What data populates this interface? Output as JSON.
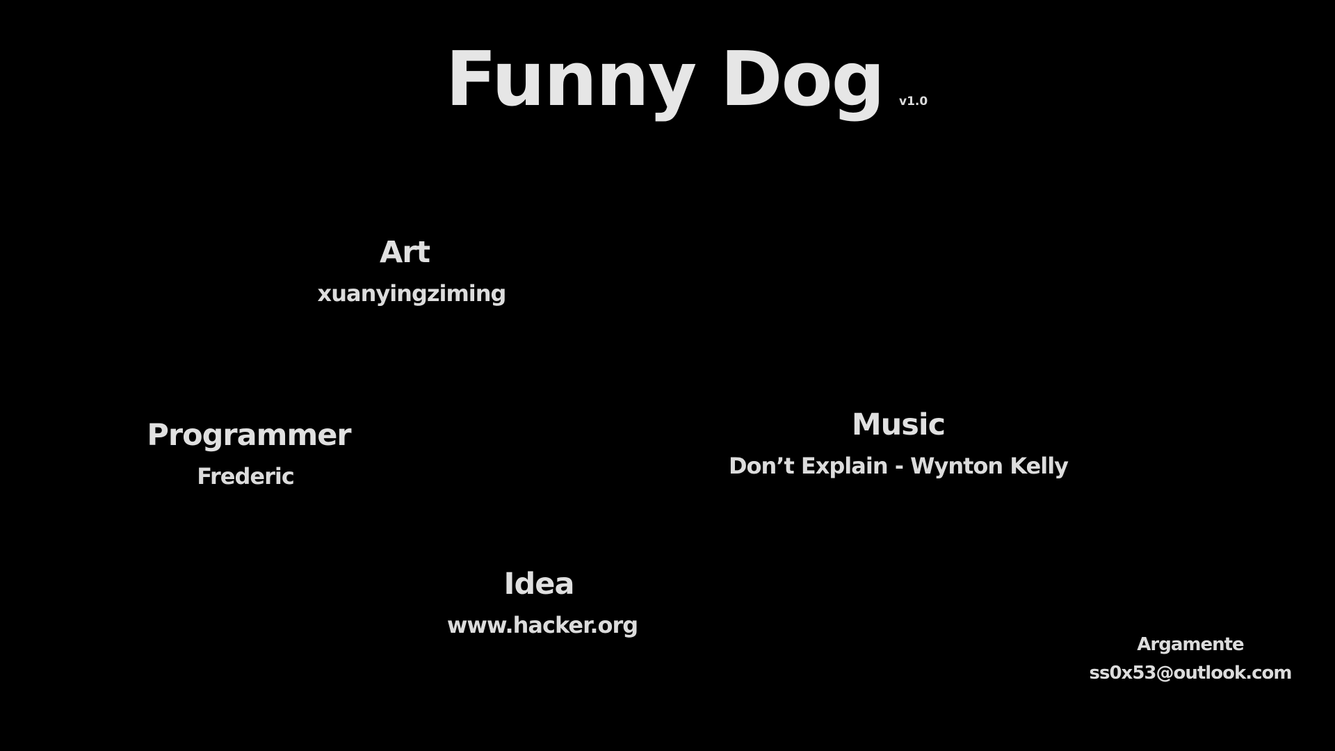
{
  "title": {
    "text": "Funny Dog",
    "version": "v1.0"
  },
  "credits": {
    "art": {
      "role": "Art",
      "name": "xuanyingziming"
    },
    "programmer": {
      "role": "Programmer",
      "name": "Frederic"
    },
    "music": {
      "role": "Music",
      "name": "Don’t Explain - Wynton Kelly"
    },
    "idea": {
      "role": "Idea",
      "name": "www.hacker.org"
    }
  },
  "contact": {
    "name": "Argamente",
    "email": "ss0x53@outlook.com"
  },
  "colors": {
    "background": "#000000",
    "text": "#dcdcdc"
  }
}
